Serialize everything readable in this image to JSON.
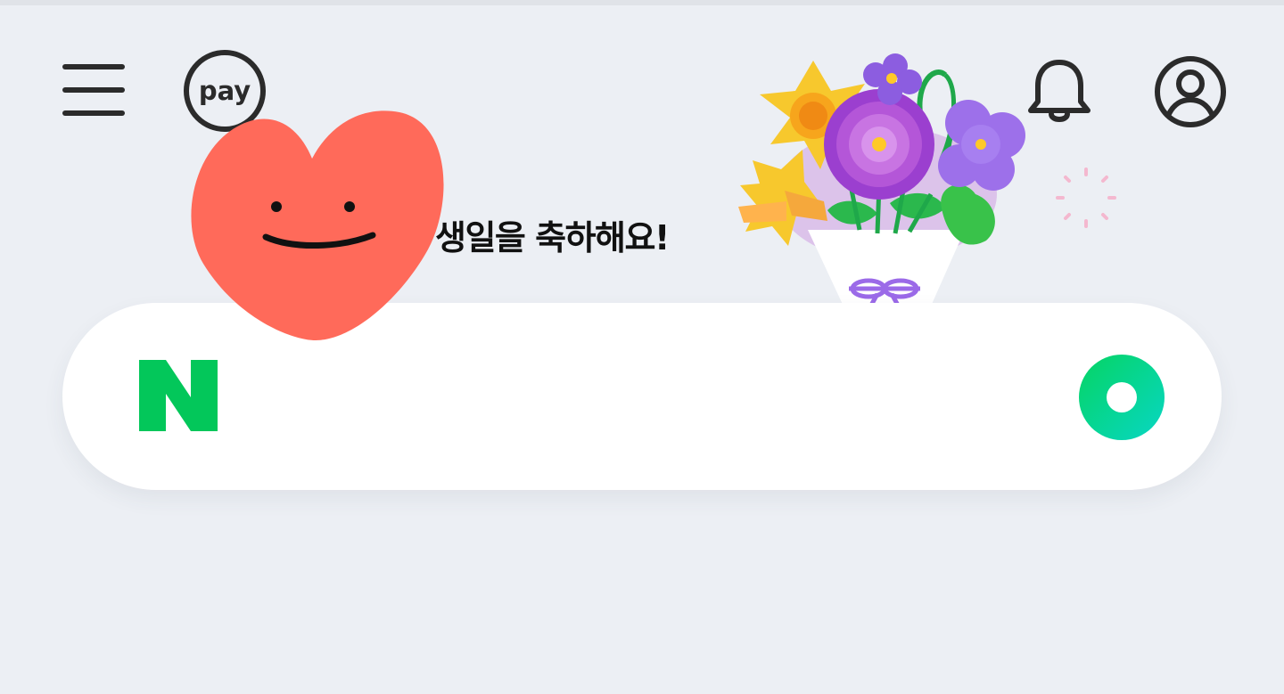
{
  "header": {
    "menu_icon": "hamburger-menu-icon",
    "pay_label": "pay",
    "bell_icon": "bell-icon",
    "profile_icon": "user-profile-icon"
  },
  "greeting": {
    "text": "생일을 축하해요!",
    "heart_icon": "smiling-heart-icon",
    "bouquet_icon": "flower-bouquet-icon"
  },
  "search": {
    "logo_letter": "N",
    "logo_icon": "naver-n-logo",
    "value": "",
    "placeholder": "",
    "green_dot_icon": "green-dot-lens-icon"
  },
  "colors": {
    "background": "#eceff4",
    "naver_green": "#03c75a",
    "heart_red": "#ff6a5a",
    "text_dark": "#111111",
    "icon_dark": "#2b2b2b"
  }
}
